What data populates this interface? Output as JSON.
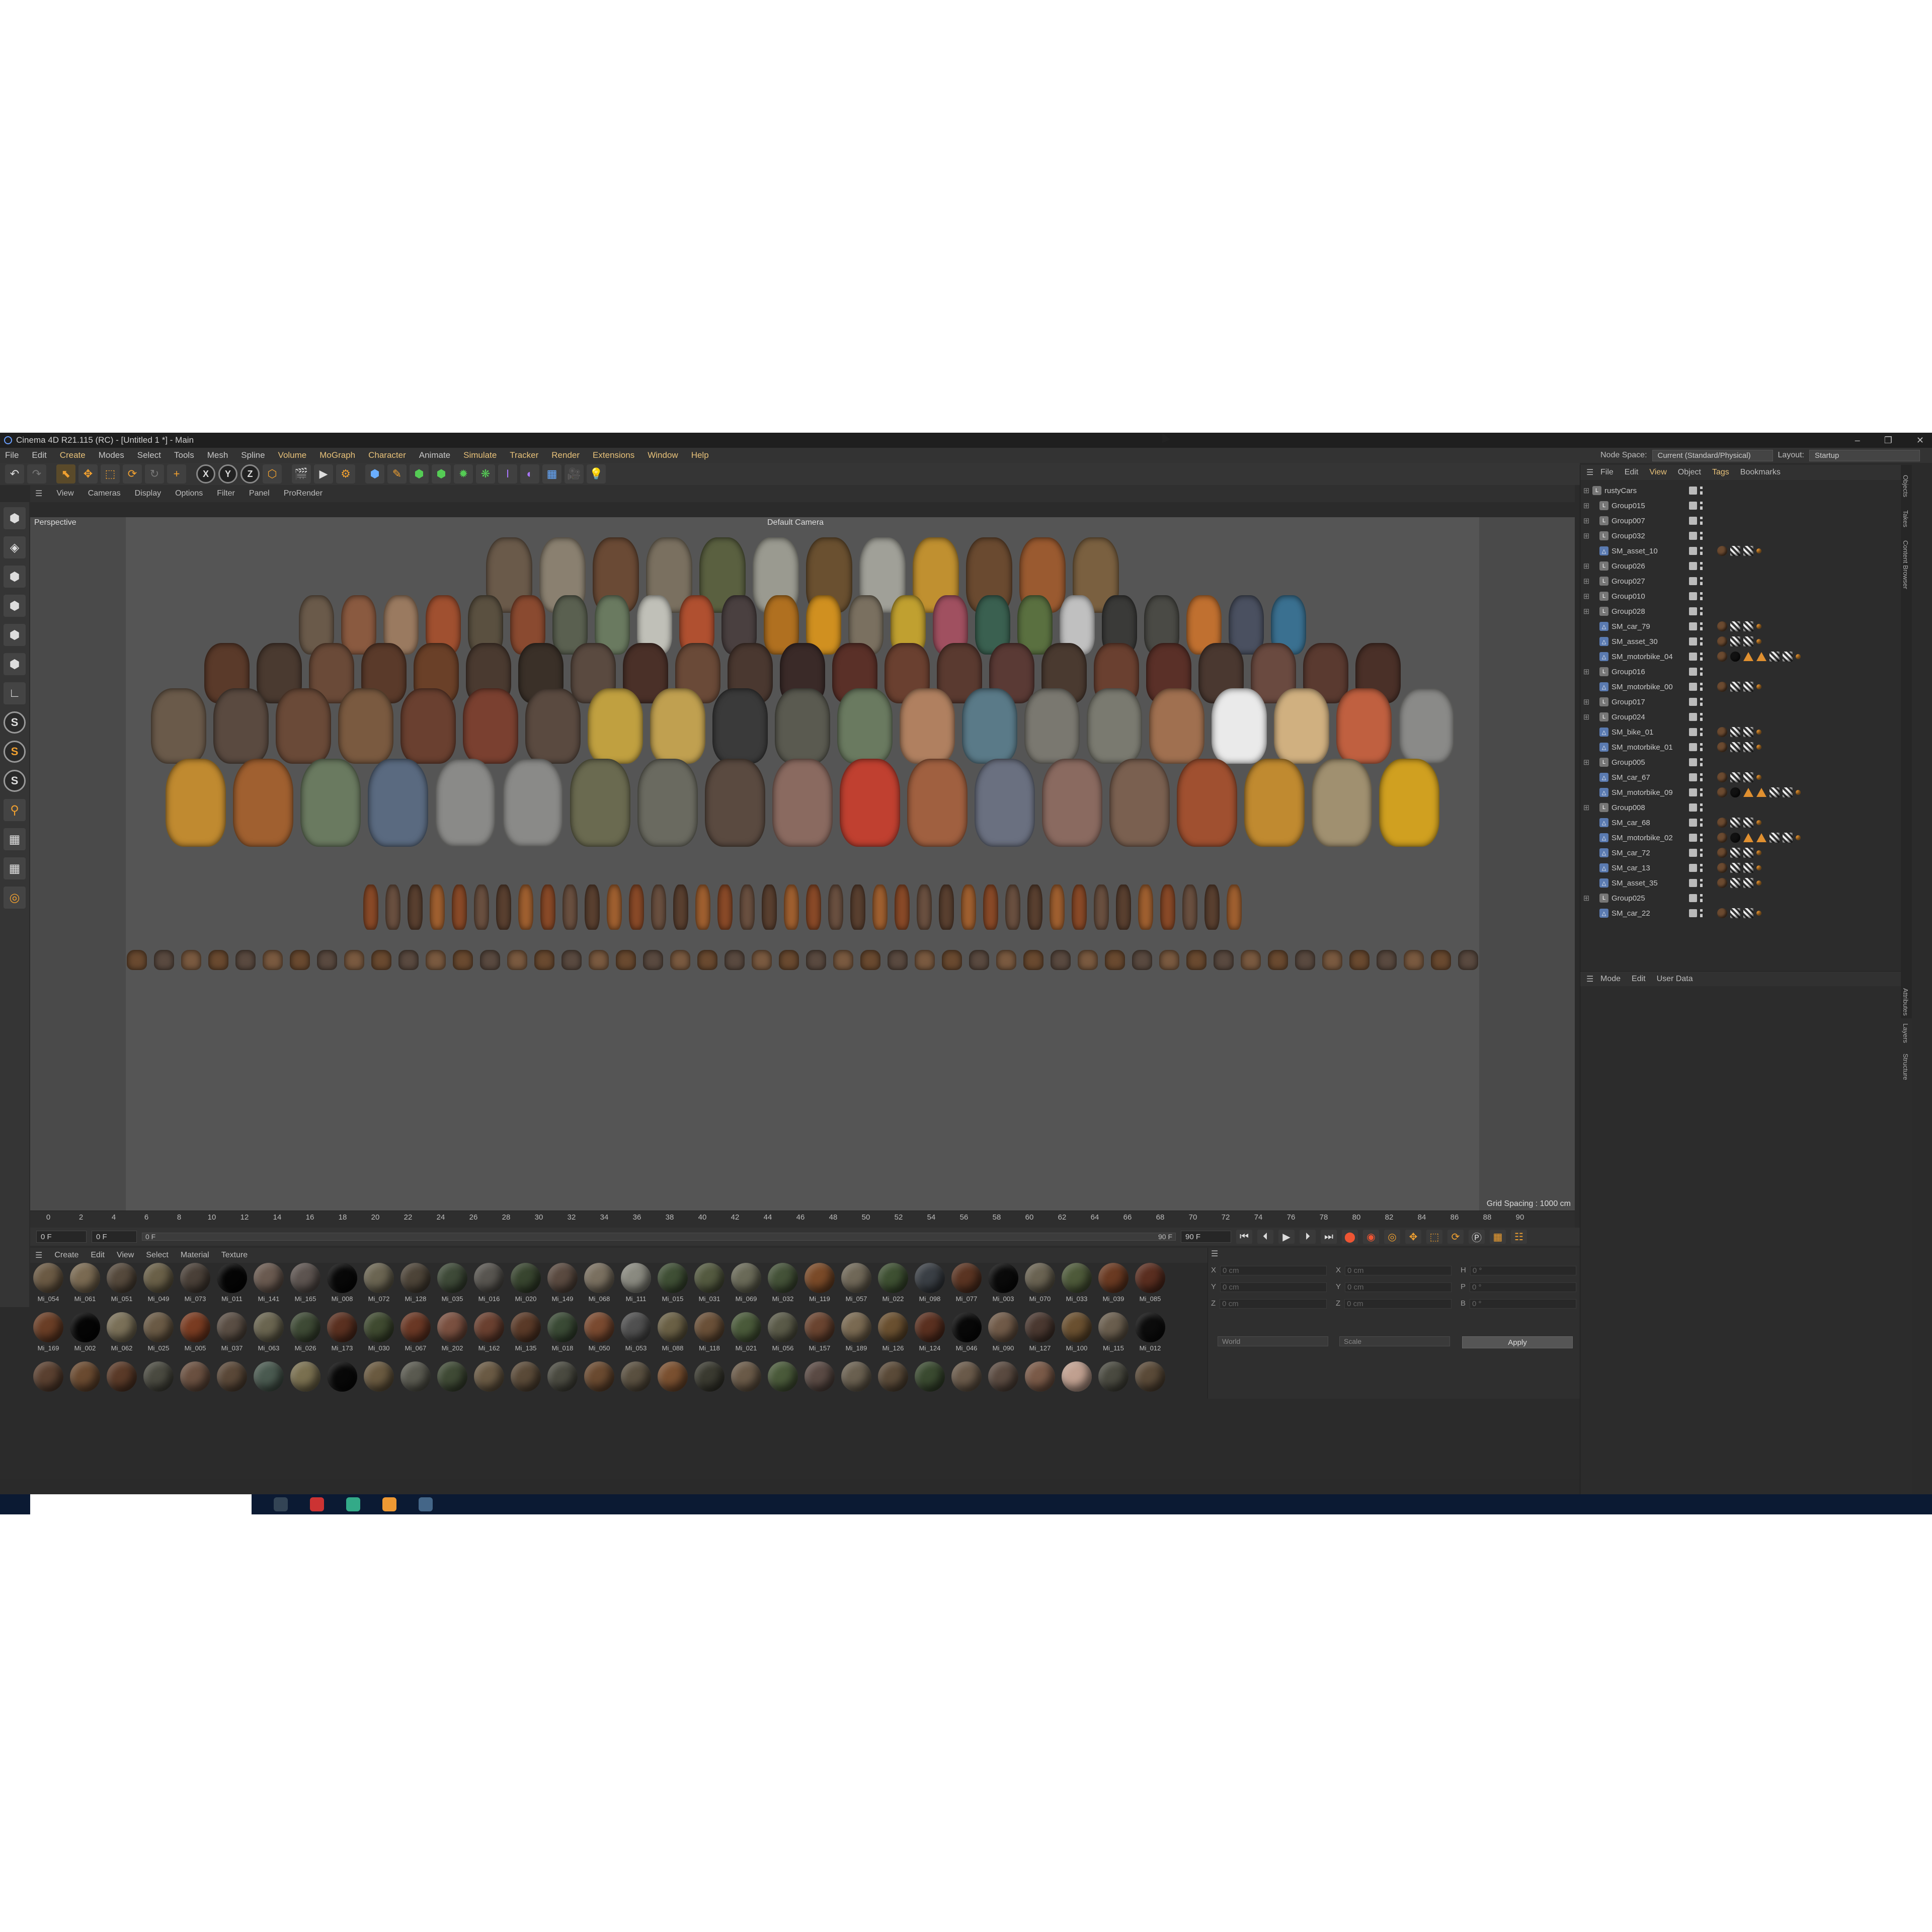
{
  "window": {
    "title": "Cinema 4D R21.115 (RC) - [Untitled 1 *] - Main",
    "controls": [
      "–",
      "❐",
      "✕"
    ]
  },
  "menu": {
    "items": [
      "File",
      "Edit",
      "Create",
      "Modes",
      "Select",
      "Tools",
      "Mesh",
      "Spline",
      "Volume",
      "MoGraph",
      "Character",
      "Animate",
      "Simulate",
      "Tracker",
      "Render",
      "Extensions",
      "Window",
      "Help"
    ],
    "node_space_label": "Node Space:",
    "node_space_value": "Current (Standard/Physical)",
    "layout_label": "Layout:",
    "layout_value": "Startup"
  },
  "viewport": {
    "menu": [
      "View",
      "Cameras",
      "Display",
      "Options",
      "Filter",
      "Panel",
      "ProRender"
    ],
    "label": "Perspective",
    "camera": "Default Camera",
    "grid_spacing": "Grid Spacing : 1000 cm"
  },
  "timeline": {
    "ticks": [
      "0",
      "2",
      "4",
      "6",
      "8",
      "10",
      "12",
      "14",
      "16",
      "18",
      "20",
      "22",
      "24",
      "26",
      "28",
      "30",
      "32",
      "34",
      "36",
      "38",
      "40",
      "42",
      "44",
      "46",
      "48",
      "50",
      "52",
      "54",
      "56",
      "58",
      "60",
      "62",
      "64",
      "66",
      "68",
      "70",
      "72",
      "74",
      "76",
      "78",
      "80",
      "82",
      "84",
      "86",
      "88",
      "90"
    ],
    "current": "0 F",
    "start": "0 F",
    "slider_start": "0 F",
    "slider_end": "90 F",
    "end": "90 F",
    "right_field": "0 F"
  },
  "materials": {
    "menu": [
      "Create",
      "Edit",
      "View",
      "Select",
      "Material",
      "Texture"
    ],
    "row1": [
      "Mi_054",
      "Mi_061",
      "Mi_051",
      "Mi_049",
      "Mi_073",
      "Mi_011",
      "Mi_141",
      "Mi_165",
      "Mi_008",
      "Mi_072",
      "Mi_128",
      "Mi_035",
      "Mi_016",
      "Mi_020",
      "Mi_149",
      "Mi_068",
      "Mi_111",
      "Mi_015",
      "Mi_031",
      "Mi_069",
      "Mi_032",
      "Mi_119",
      "Mi_057",
      "Mi_022",
      "Mi_098",
      "Mi_077",
      "Mi_003",
      "Mi_070",
      "Mi_033",
      "Mi_039",
      "Mi_085"
    ],
    "row2": [
      "Mi_169",
      "Mi_002",
      "Mi_062",
      "Mi_025",
      "Mi_005",
      "Mi_037",
      "Mi_063",
      "Mi_026",
      "Mi_173",
      "Mi_030",
      "Mi_067",
      "Mi_202",
      "Mi_162",
      "Mi_135",
      "Mi_018",
      "Mi_050",
      "Mi_053",
      "Mi_088",
      "Mi_118",
      "Mi_021",
      "Mi_056",
      "Mi_157",
      "Mi_189",
      "Mi_126",
      "Mi_124",
      "Mi_046",
      "Mi_090",
      "Mi_127",
      "Mi_100",
      "Mi_115",
      "Mi_012"
    ],
    "colors1": [
      "#6b5a44",
      "#7a6a52",
      "#55493c",
      "#6a6048",
      "#4a4038",
      "#050505",
      "#6a5a50",
      "#5d5450",
      "#080808",
      "#6b6552",
      "#4d4438",
      "#3e4a38",
      "#585550",
      "#38452f",
      "#5a4a40",
      "#7a7060",
      "#8a8a80",
      "#3f4f35",
      "#545a40",
      "#6a6a58",
      "#445238",
      "#7a4a28",
      "#706858",
      "#3e5032",
      "#3a3f45",
      "#5a3422",
      "#0a0a0a",
      "#6a6352",
      "#4e5a3a",
      "#6a3a22",
      "#5a2e20"
    ],
    "colors2": [
      "#6a3e26",
      "#050505",
      "#7a7058",
      "#6a5a45",
      "#7a3c22",
      "#5a4e44",
      "#6a6550",
      "#3e4a35",
      "#5a3020",
      "#3f4a30",
      "#6a3825",
      "#7a5040",
      "#6a4030",
      "#5a3a28",
      "#3a4a35",
      "#7a4a30",
      "#505050",
      "#6a6045",
      "#6a5038",
      "#4a5a3a",
      "#5a5a48",
      "#6a4430",
      "#7a6a52",
      "#6a5030",
      "#5a3020",
      "#080808",
      "#705a48",
      "#4a3830",
      "#6a5030",
      "#6a5e4e",
      "#0c0c0c"
    ],
    "colors3": [
      "#5a4030",
      "#6a4a30",
      "#5a3a28",
      "#4a4a40",
      "#6a5040",
      "#5a4838",
      "#4a5a50",
      "#7a7050",
      "#080808",
      "#6a5a40",
      "#5a5a50",
      "#3f4a35",
      "#6a5a44",
      "#5a4a38",
      "#4a4a40",
      "#6a4a30",
      "#5a5040",
      "#7a5030",
      "#3a3a30",
      "#6a5a48",
      "#4a5a3a",
      "#5a4a44",
      "#6a6050",
      "#5a4a38",
      "#3a4a30",
      "#6a5a4a",
      "#5a4a40",
      "#7a5a48",
      "#c0a090",
      "#4a4a40",
      "#5a4a38"
    ]
  },
  "coords": {
    "rows": [
      [
        "X",
        "0 cm",
        "X",
        "0 cm",
        "H",
        "0 °"
      ],
      [
        "Y",
        "0 cm",
        "Y",
        "0 cm",
        "P",
        "0 °"
      ],
      [
        "Z",
        "0 cm",
        "Z",
        "0 cm",
        "B",
        "0 °"
      ]
    ],
    "mode1": "World",
    "mode2": "Scale",
    "apply": "Apply"
  },
  "objects": {
    "menu": [
      "File",
      "Edit",
      "View",
      "Object",
      "Tags",
      "Bookmarks"
    ],
    "items": [
      {
        "name": "rustyCars",
        "type": "null",
        "tags": []
      },
      {
        "name": "Group015",
        "type": "null",
        "tags": []
      },
      {
        "name": "Group007",
        "type": "null",
        "tags": []
      },
      {
        "name": "Group032",
        "type": "null",
        "tags": []
      },
      {
        "name": "SM_asset_10",
        "type": "mesh",
        "tags": [
          "m",
          "c",
          "c",
          "d"
        ]
      },
      {
        "name": "Group026",
        "type": "null",
        "tags": []
      },
      {
        "name": "Group027",
        "type": "null",
        "tags": []
      },
      {
        "name": "Group010",
        "type": "null",
        "tags": []
      },
      {
        "name": "Group028",
        "type": "null",
        "tags": []
      },
      {
        "name": "SM_car_79",
        "type": "mesh",
        "tags": [
          "m",
          "c",
          "c",
          "d"
        ]
      },
      {
        "name": "SM_asset_30",
        "type": "mesh",
        "tags": [
          "m",
          "c",
          "c",
          "d"
        ]
      },
      {
        "name": "SM_motorbike_04",
        "type": "mesh",
        "tags": [
          "m",
          "b",
          "t",
          "t",
          "c",
          "c",
          "d"
        ]
      },
      {
        "name": "Group016",
        "type": "null",
        "tags": []
      },
      {
        "name": "SM_motorbike_00",
        "type": "mesh",
        "tags": [
          "m",
          "c",
          "c",
          "d"
        ]
      },
      {
        "name": "Group017",
        "type": "null",
        "tags": []
      },
      {
        "name": "Group024",
        "type": "null",
        "tags": []
      },
      {
        "name": "SM_bike_01",
        "type": "mesh",
        "tags": [
          "m",
          "c",
          "c",
          "d"
        ]
      },
      {
        "name": "SM_motorbike_01",
        "type": "mesh",
        "tags": [
          "m",
          "c",
          "c",
          "d"
        ]
      },
      {
        "name": "Group005",
        "type": "null",
        "tags": []
      },
      {
        "name": "SM_car_67",
        "type": "mesh",
        "tags": [
          "m",
          "c",
          "c",
          "d"
        ]
      },
      {
        "name": "SM_motorbike_09",
        "type": "mesh",
        "tags": [
          "m",
          "b",
          "t",
          "t",
          "c",
          "c",
          "d"
        ]
      },
      {
        "name": "Group008",
        "type": "null",
        "tags": []
      },
      {
        "name": "SM_car_68",
        "type": "mesh",
        "tags": [
          "m",
          "c",
          "c",
          "d"
        ]
      },
      {
        "name": "SM_motorbike_02",
        "type": "mesh",
        "tags": [
          "m",
          "b",
          "t",
          "t",
          "c",
          "c",
          "d"
        ]
      },
      {
        "name": "SM_car_72",
        "type": "mesh",
        "tags": [
          "m",
          "c",
          "c",
          "d"
        ]
      },
      {
        "name": "SM_car_13",
        "type": "mesh",
        "tags": [
          "m",
          "c",
          "c",
          "d"
        ]
      },
      {
        "name": "SM_asset_35",
        "type": "mesh",
        "tags": [
          "m",
          "c",
          "c",
          "d"
        ]
      },
      {
        "name": "Group025",
        "type": "null",
        "tags": []
      },
      {
        "name": "SM_car_22",
        "type": "mesh",
        "tags": [
          "m",
          "c",
          "c",
          "d"
        ]
      }
    ]
  },
  "attributes": {
    "menu": [
      "Mode",
      "Edit",
      "User Data"
    ]
  },
  "side_tabs": [
    "Objects",
    "Takes",
    "Content Browser",
    "Attributes",
    "Layers",
    "Structure"
  ],
  "scene": {
    "rows": [
      [
        "#6a5a4a",
        "#8a8070",
        "#6a4a35",
        "#7a7060",
        "#5a6040",
        "#9a9a90",
        "#6a5030",
        "#a0a098",
        "#c09030",
        "#6a4a30",
        "#9a5a30",
        "#7a6040"
      ],
      [
        "#6a5a4a",
        "#8a5a40",
        "#9a7a60",
        "#a05030",
        "#5a5040",
        "#8a4a30",
        "#5a6050",
        "#6a7a60",
        "#c0c0b8",
        "#b05030",
        "#4a4040",
        "#b07020",
        "#d09020",
        "#7a7060",
        "#c0a030",
        "#a05060",
        "#3a6050",
        "#5a7040",
        "#c0c0c0",
        "#3a3a38",
        "#4a4a45",
        "#c07030",
        "#4a5060",
        "#3a7090"
      ],
      [
        "#5a3a2a",
        "#4a3a30",
        "#6a4a38",
        "#5a3a2a",
        "#6a4028",
        "#4a3a30",
        "#3a3028",
        "#5a4a40",
        "#4a3028",
        "#6a4a38",
        "#4a3830",
        "#3a2a28",
        "#5a3028",
        "#6a4030",
        "#5a3a30",
        "#5a3a35",
        "#4a3a30",
        "#6a4030",
        "#5a3028",
        "#4a3830",
        "#6a4a40",
        "#5a3a30",
        "#4a3028"
      ],
      [
        "#6a5a4a",
        "#5a4a40",
        "#6a4a38",
        "#7a5a40",
        "#6a4030",
        "#7a4030",
        "#5a4a40",
        "#c0a040",
        "#c0a050",
        "#3a3a3a",
        "#5a5a50",
        "#6a7a60",
        "#b08060",
        "#5a7a88",
        "#7a7870",
        "#7a7a70",
        "#a07050",
        "#eaeaea",
        "#d0b080",
        "#c06040",
        "#8a8a88"
      ],
      [
        "#c08a30",
        "#a06030",
        "#6a7a60",
        "#5a6a80",
        "#8a8a88",
        "#8a8a88",
        "#6a6a50",
        "#6a6a60",
        "#5a4a40",
        "#8a6a60",
        "#c04030",
        "#a06040",
        "#6a7080",
        "#8a6a60",
        "#7a6050",
        "#a05030",
        "#c08a30",
        "#a09070",
        "#d0a020"
      ]
    ]
  }
}
